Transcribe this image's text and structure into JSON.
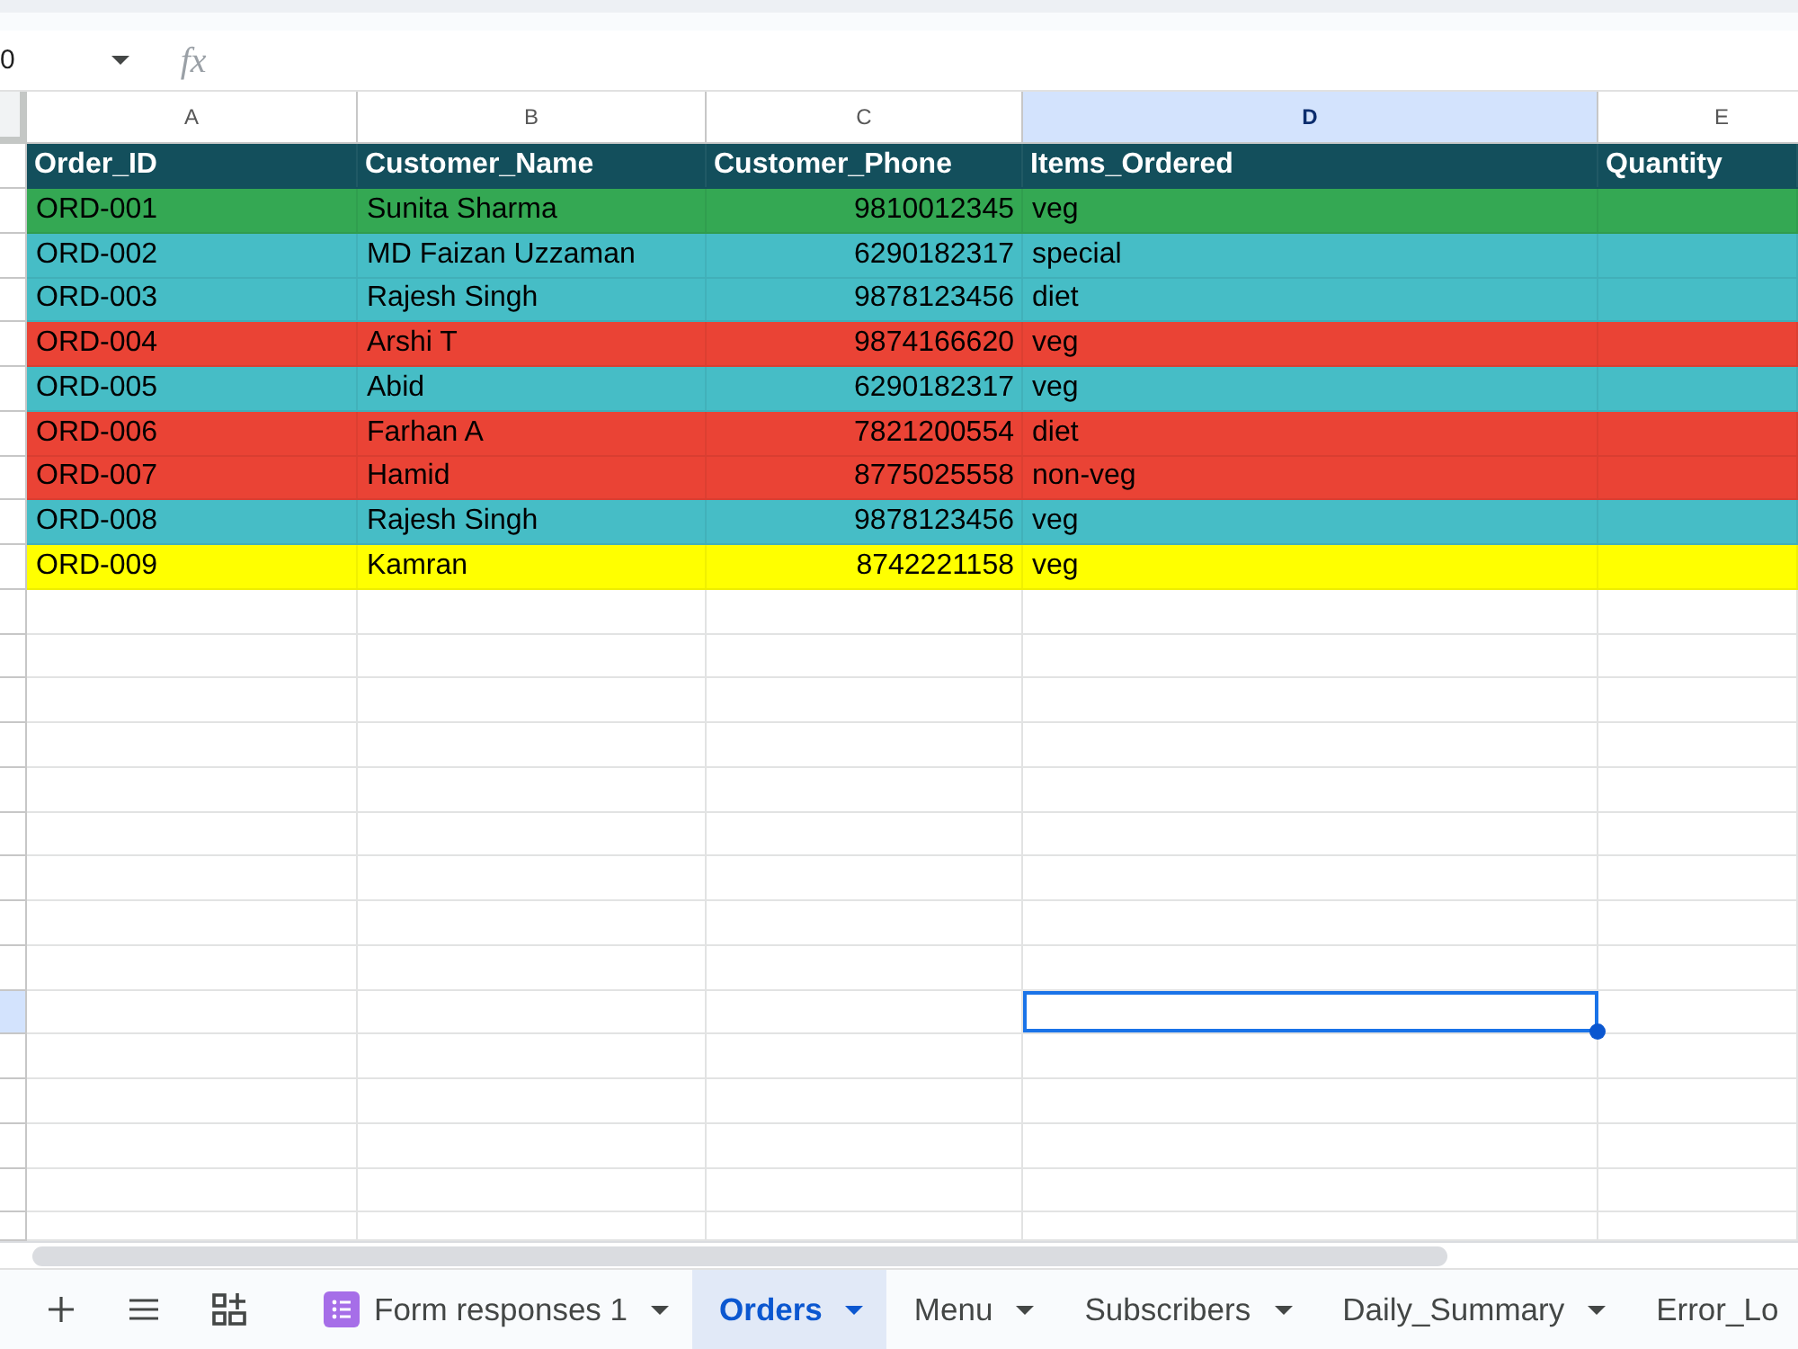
{
  "name_box": {
    "value": "0"
  },
  "formula_bar": {
    "fx_label": "fx"
  },
  "columns": [
    {
      "letter": "A",
      "selected": false,
      "kind": "text"
    },
    {
      "letter": "B",
      "selected": false,
      "kind": "text"
    },
    {
      "letter": "C",
      "selected": false,
      "kind": "number"
    },
    {
      "letter": "D",
      "selected": true,
      "kind": "text"
    },
    {
      "letter": "E",
      "selected": false,
      "kind": "text"
    }
  ],
  "header_row": [
    "Order_ID",
    "Customer_Name",
    "Customer_Phone",
    "Items_Ordered",
    "Quantity"
  ],
  "rows": [
    {
      "cells": [
        "ORD-001",
        "Sunita Sharma",
        "9810012345",
        "veg"
      ],
      "color": "#34a853"
    },
    {
      "cells": [
        "ORD-002",
        "MD Faizan Uzzaman",
        "6290182317",
        "special"
      ],
      "color": "#46bdc6"
    },
    {
      "cells": [
        "ORD-003",
        "Rajesh Singh",
        "9878123456",
        "diet"
      ],
      "color": "#46bdc6"
    },
    {
      "cells": [
        "ORD-004",
        "Arshi T",
        "9874166620",
        "veg"
      ],
      "color": "#ea4335"
    },
    {
      "cells": [
        "ORD-005",
        "Abid",
        "6290182317",
        "veg"
      ],
      "color": "#46bdc6"
    },
    {
      "cells": [
        "ORD-006",
        "Farhan A",
        "7821200554",
        "diet"
      ],
      "color": "#ea4335"
    },
    {
      "cells": [
        "ORD-007",
        "Hamid",
        "8775025558",
        "non-veg"
      ],
      "color": "#ea4335"
    },
    {
      "cells": [
        "ORD-008",
        "Rajesh Singh",
        "9878123456",
        "veg"
      ],
      "color": "#46bdc6"
    },
    {
      "cells": [
        "ORD-009",
        "Kamran",
        "8742221158",
        "veg"
      ],
      "color": "#ffff00"
    }
  ],
  "row_headers": [
    {
      "selected": false
    },
    {
      "selected": false
    },
    {
      "selected": false
    },
    {
      "selected": false
    },
    {
      "selected": false
    },
    {
      "selected": false
    },
    {
      "selected": false
    },
    {
      "selected": false
    },
    {
      "selected": false
    },
    {
      "selected": false
    },
    {
      "selected": false
    },
    {
      "selected": false
    },
    {
      "selected": false
    },
    {
      "selected": false
    },
    {
      "selected": false
    },
    {
      "selected": false
    },
    {
      "selected": false
    },
    {
      "selected": false
    },
    {
      "selected": false
    },
    {
      "selected": true
    },
    {
      "selected": false
    },
    {
      "selected": false
    },
    {
      "selected": false
    },
    {
      "selected": false
    },
    {
      "selected": false
    }
  ],
  "sheet_tabs": [
    {
      "label": "Form responses 1",
      "kind": "form",
      "selected": false,
      "menu_caret": true
    },
    {
      "label": "Orders",
      "kind": "sheet",
      "selected": true,
      "menu_caret": true
    },
    {
      "label": "Menu",
      "kind": "sheet",
      "selected": false,
      "menu_caret": true
    },
    {
      "label": "Subscribers",
      "kind": "sheet",
      "selected": false,
      "menu_caret": true
    },
    {
      "label": "Daily_Summary",
      "kind": "sheet",
      "selected": false,
      "menu_caret": true
    },
    {
      "label": "Error_Lo",
      "kind": "sheet",
      "selected": false,
      "menu_caret": false
    }
  ]
}
